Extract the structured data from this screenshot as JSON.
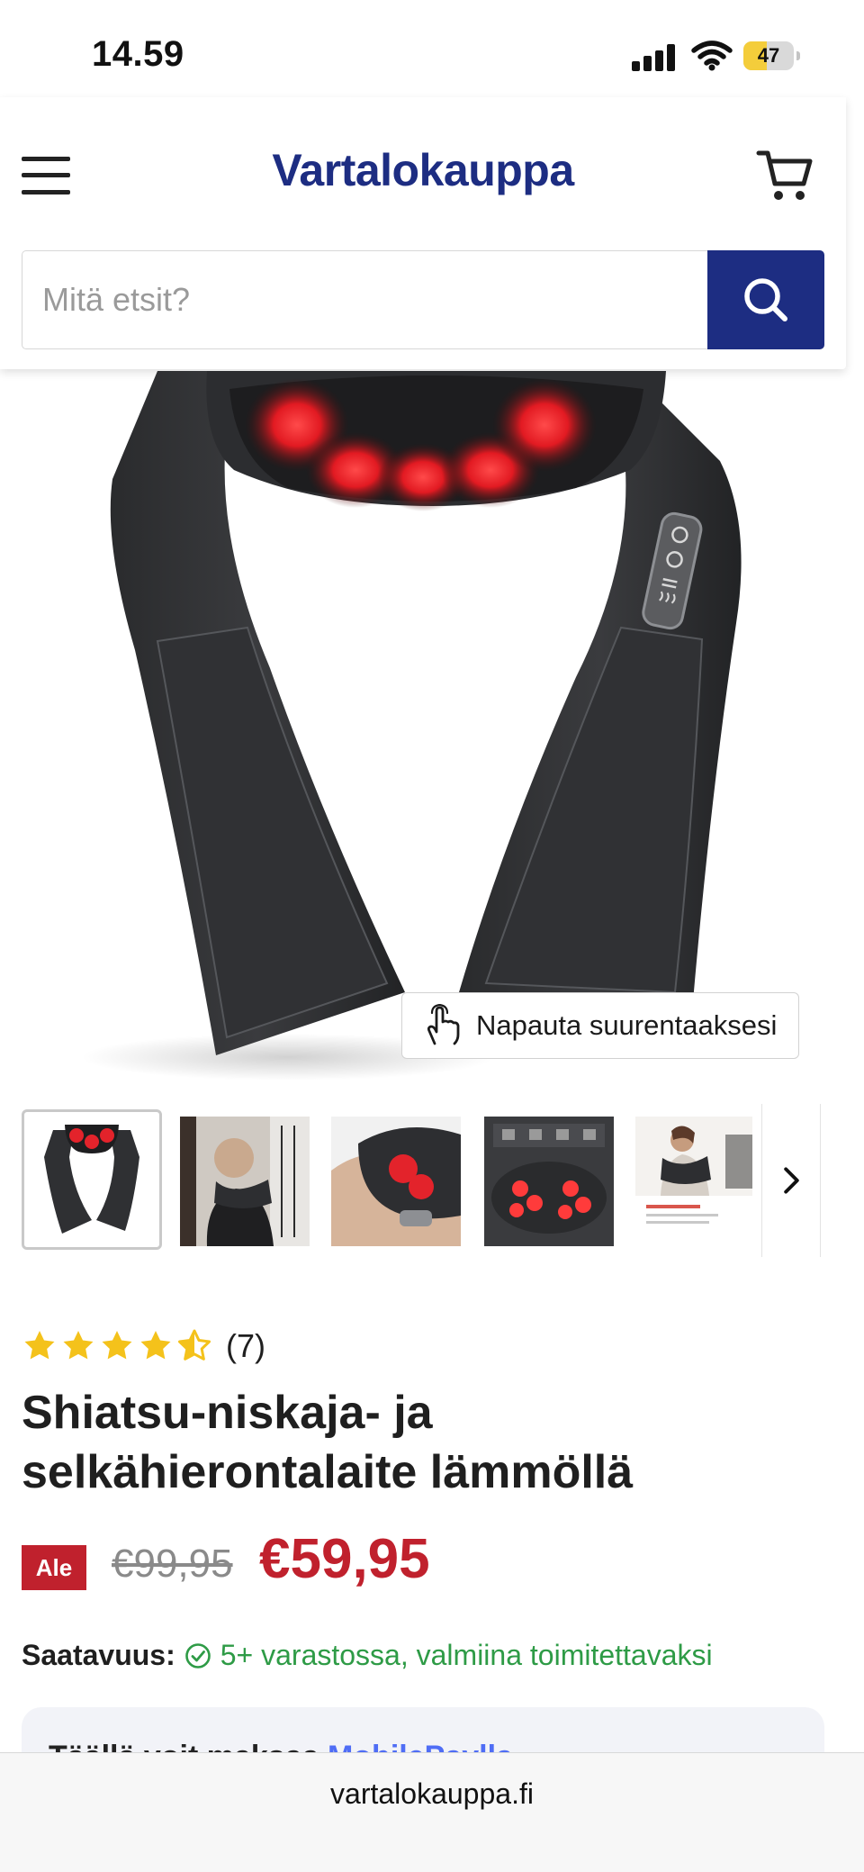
{
  "status_bar": {
    "time": "14.59",
    "battery_level": "47",
    "battery_fraction": 0.47,
    "icons": [
      "signal-icon",
      "wifi-icon",
      "battery-charging-icon"
    ]
  },
  "header": {
    "logo": "Vartalokauppa",
    "icons": [
      "menu-icon",
      "cart-icon"
    ]
  },
  "search": {
    "placeholder": "Mitä etsit?",
    "value": "",
    "button_icon": "search-icon"
  },
  "gallery": {
    "zoom_hint": "Napauta suurentaaksesi",
    "zoom_icon": "tap-hand-icon",
    "next_icon": "chevron-right-icon",
    "thumbnail_count_visible": 5
  },
  "product": {
    "rating": 4.5,
    "rating_max": 5,
    "review_count": "(7)",
    "title": "Shiatsu-niskaja- ja selkähierontalaite lämmöllä",
    "sale_badge": "Ale",
    "old_price": "€99,95",
    "price": "€59,95",
    "availability_label": "Saatavuus:",
    "availability_value": "5+ varastossa, valmiina toimitettavaksi",
    "mobilepay_text": "Täällä voit maksaa",
    "mobilepay_link": "MobilePaylla"
  },
  "browser": {
    "url": "vartalokauppa.fi"
  },
  "colors": {
    "brand": "#1d2d82",
    "sale": "#c0212d",
    "in_stock": "#2e9b46",
    "star": "#f4c21b",
    "mobilepay_link": "#4f6df5"
  }
}
